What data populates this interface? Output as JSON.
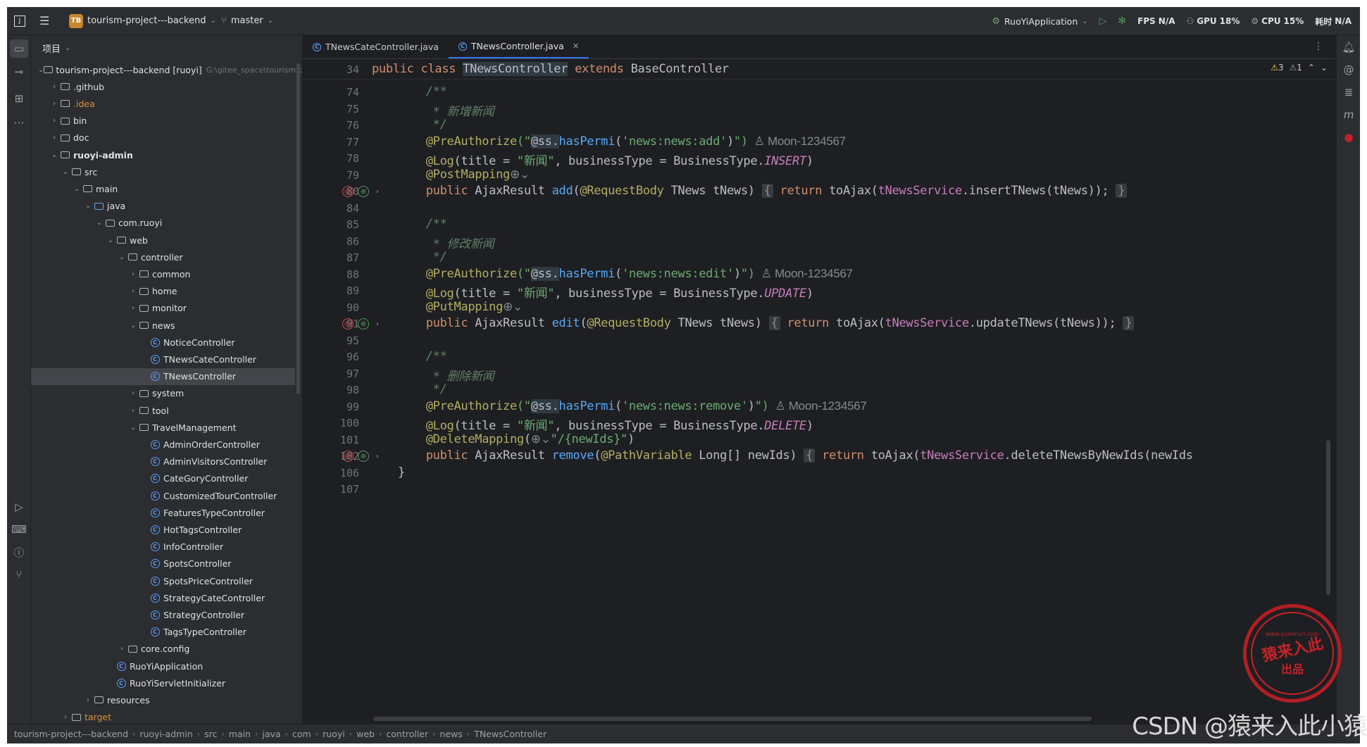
{
  "titlebar": {
    "project_badge": "TB",
    "project_name": "tourism-project---backend",
    "branch": "master",
    "run_config": "RuoYiApplication",
    "fps_label": "FPS",
    "fps_value": "N/A",
    "gpu_label": "GPU",
    "gpu_value": "18%",
    "cpu_label": "CPU",
    "cpu_value": "15%",
    "time_label": "耗时",
    "time_value": "N/A"
  },
  "project_panel": {
    "title": "项目",
    "tree": [
      {
        "label": "tourism-project---backend [ruoyi]",
        "extra": "G:\\gitee_space\\tourism-project---backend",
        "depth": 0,
        "arrow": "open",
        "icon": "module",
        "style": "root"
      },
      {
        "label": ".github",
        "depth": 1,
        "arrow": "closed",
        "icon": "folder"
      },
      {
        "label": ".idea",
        "depth": 1,
        "arrow": "closed",
        "icon": "folder",
        "style": "orange"
      },
      {
        "label": "bin",
        "depth": 1,
        "arrow": "closed",
        "icon": "folder"
      },
      {
        "label": "doc",
        "depth": 1,
        "arrow": "closed",
        "icon": "folder"
      },
      {
        "label": "ruoyi-admin",
        "depth": 1,
        "arrow": "open",
        "icon": "module",
        "style": "bold"
      },
      {
        "label": "src",
        "depth": 2,
        "arrow": "open",
        "icon": "folder"
      },
      {
        "label": "main",
        "depth": 3,
        "arrow": "open",
        "icon": "folder"
      },
      {
        "label": "java",
        "depth": 4,
        "arrow": "open",
        "icon": "folder-blue"
      },
      {
        "label": "com.ruoyi",
        "depth": 5,
        "arrow": "open",
        "icon": "package"
      },
      {
        "label": "web",
        "depth": 6,
        "arrow": "open",
        "icon": "package"
      },
      {
        "label": "controller",
        "depth": 7,
        "arrow": "open",
        "icon": "package"
      },
      {
        "label": "common",
        "depth": 8,
        "arrow": "closed",
        "icon": "package"
      },
      {
        "label": "home",
        "depth": 8,
        "arrow": "closed",
        "icon": "package"
      },
      {
        "label": "monitor",
        "depth": 8,
        "arrow": "closed",
        "icon": "package"
      },
      {
        "label": "news",
        "depth": 8,
        "arrow": "open",
        "icon": "package"
      },
      {
        "label": "NoticeController",
        "depth": 9,
        "arrow": "none",
        "icon": "class"
      },
      {
        "label": "TNewsCateController",
        "depth": 9,
        "arrow": "none",
        "icon": "class"
      },
      {
        "label": "TNewsController",
        "depth": 9,
        "arrow": "none",
        "icon": "class",
        "selected": true
      },
      {
        "label": "system",
        "depth": 8,
        "arrow": "closed",
        "icon": "package"
      },
      {
        "label": "tool",
        "depth": 8,
        "arrow": "closed",
        "icon": "package"
      },
      {
        "label": "TravelManagement",
        "depth": 8,
        "arrow": "open",
        "icon": "package"
      },
      {
        "label": "AdminOrderController",
        "depth": 9,
        "arrow": "none",
        "icon": "class"
      },
      {
        "label": "AdminVisitorsController",
        "depth": 9,
        "arrow": "none",
        "icon": "class"
      },
      {
        "label": "CateGoryController",
        "depth": 9,
        "arrow": "none",
        "icon": "class"
      },
      {
        "label": "CustomizedTourController",
        "depth": 9,
        "arrow": "none",
        "icon": "class"
      },
      {
        "label": "FeaturesTypeController",
        "depth": 9,
        "arrow": "none",
        "icon": "class"
      },
      {
        "label": "HotTagsController",
        "depth": 9,
        "arrow": "none",
        "icon": "class"
      },
      {
        "label": "InfoController",
        "depth": 9,
        "arrow": "none",
        "icon": "class"
      },
      {
        "label": "SpotsController",
        "depth": 9,
        "arrow": "none",
        "icon": "class"
      },
      {
        "label": "SpotsPriceController",
        "depth": 9,
        "arrow": "none",
        "icon": "class"
      },
      {
        "label": "StrategyCateController",
        "depth": 9,
        "arrow": "none",
        "icon": "class"
      },
      {
        "label": "StrategyController",
        "depth": 9,
        "arrow": "none",
        "icon": "class"
      },
      {
        "label": "TagsTypeController",
        "depth": 9,
        "arrow": "none",
        "icon": "class"
      },
      {
        "label": "core.config",
        "depth": 7,
        "arrow": "closed",
        "icon": "package"
      },
      {
        "label": "RuoYiApplication",
        "depth": 6,
        "arrow": "none",
        "icon": "class-run"
      },
      {
        "label": "RuoYiServletInitializer",
        "depth": 6,
        "arrow": "none",
        "icon": "class"
      },
      {
        "label": "resources",
        "depth": 4,
        "arrow": "closed",
        "icon": "folder"
      },
      {
        "label": "target",
        "depth": 2,
        "arrow": "closed",
        "icon": "folder",
        "style": "orange"
      }
    ]
  },
  "editor": {
    "tabs": [
      {
        "label": "TNewsCateController.java",
        "active": false
      },
      {
        "label": "TNewsController.java",
        "active": true
      }
    ],
    "warnings": "3",
    "weak_warnings": "1",
    "sticky_line_number": "34",
    "sticky_line": [
      {
        "t": "public class ",
        "c": "kw"
      },
      {
        "t": "TNewsController",
        "c": "hl"
      },
      {
        "t": " extends ",
        "c": "kw"
      },
      {
        "t": "BaseController",
        "c": ""
      }
    ],
    "lines": [
      {
        "n": "74",
        "tokens": [
          {
            "t": "    /**",
            "c": "cm"
          }
        ]
      },
      {
        "n": "75",
        "tokens": [
          {
            "t": "     * 新增新闻",
            "c": "cm"
          }
        ]
      },
      {
        "n": "76",
        "tokens": [
          {
            "t": "     */",
            "c": "cm"
          }
        ]
      },
      {
        "n": "77",
        "tokens": [
          {
            "t": "    @PreAuthorize",
            "c": "an"
          },
          {
            "t": "(\"",
            "c": "str"
          },
          {
            "t": "@ss.",
            "c": "hl"
          },
          {
            "t": "hasPermi",
            "c": "fn"
          },
          {
            "t": "(",
            "c": ""
          },
          {
            "t": "'news:news:add'",
            "c": "str"
          },
          {
            "t": ")",
            "c": ""
          },
          {
            "t": "\")",
            "c": "str"
          },
          {
            "t": "  ♙ Moon-1234567",
            "c": "hint"
          }
        ]
      },
      {
        "n": "78",
        "tokens": [
          {
            "t": "    @Log",
            "c": "an"
          },
          {
            "t": "(title = ",
            "c": ""
          },
          {
            "t": "\"新闻\"",
            "c": "str"
          },
          {
            "t": ", businessType = BusinessType.",
            "c": ""
          },
          {
            "t": "INSERT",
            "c": "it"
          },
          {
            "t": ")",
            "c": ""
          }
        ]
      },
      {
        "n": "79",
        "tokens": [
          {
            "t": "    @PostMapping",
            "c": "an"
          },
          {
            "t": "⊕⌄",
            "c": "hint"
          }
        ]
      },
      {
        "n": "80",
        "tokens": [
          {
            "t": "    public ",
            "c": "kw"
          },
          {
            "t": "AjaxResult ",
            "c": ""
          },
          {
            "t": "add",
            "c": "fn"
          },
          {
            "t": "(",
            "c": ""
          },
          {
            "t": "@RequestBody",
            "c": "an"
          },
          {
            "t": " TNews tNews) ",
            "c": ""
          },
          {
            "t": "{",
            "c": "fold"
          },
          {
            "t": " return ",
            "c": "kw"
          },
          {
            "t": "toAjax(",
            "c": ""
          },
          {
            "t": "tNewsService",
            "c": "fld"
          },
          {
            "t": ".insertTNews(tNews)); ",
            "c": ""
          },
          {
            "t": "}",
            "c": "fold"
          }
        ],
        "gutter": true
      },
      {
        "n": "84",
        "tokens": [
          {
            "t": "",
            "c": ""
          }
        ]
      },
      {
        "n": "85",
        "tokens": [
          {
            "t": "    /**",
            "c": "cm"
          }
        ]
      },
      {
        "n": "86",
        "tokens": [
          {
            "t": "     * 修改新闻",
            "c": "cm"
          }
        ]
      },
      {
        "n": "87",
        "tokens": [
          {
            "t": "     */",
            "c": "cm"
          }
        ]
      },
      {
        "n": "88",
        "tokens": [
          {
            "t": "    @PreAuthorize",
            "c": "an"
          },
          {
            "t": "(\"",
            "c": "str"
          },
          {
            "t": "@ss.",
            "c": "hl"
          },
          {
            "t": "hasPermi",
            "c": "fn"
          },
          {
            "t": "(",
            "c": ""
          },
          {
            "t": "'news:news:edit'",
            "c": "str"
          },
          {
            "t": ")",
            "c": ""
          },
          {
            "t": "\")",
            "c": "str"
          },
          {
            "t": "  ♙ Moon-1234567",
            "c": "hint"
          }
        ]
      },
      {
        "n": "89",
        "tokens": [
          {
            "t": "    @Log",
            "c": "an"
          },
          {
            "t": "(title = ",
            "c": ""
          },
          {
            "t": "\"新闻\"",
            "c": "str"
          },
          {
            "t": ", businessType = BusinessType.",
            "c": ""
          },
          {
            "t": "UPDATE",
            "c": "it"
          },
          {
            "t": ")",
            "c": ""
          }
        ]
      },
      {
        "n": "90",
        "tokens": [
          {
            "t": "    @PutMapping",
            "c": "an"
          },
          {
            "t": "⊕⌄",
            "c": "hint"
          }
        ]
      },
      {
        "n": "91",
        "tokens": [
          {
            "t": "    public ",
            "c": "kw"
          },
          {
            "t": "AjaxResult ",
            "c": ""
          },
          {
            "t": "edit",
            "c": "fn"
          },
          {
            "t": "(",
            "c": ""
          },
          {
            "t": "@RequestBody",
            "c": "an"
          },
          {
            "t": " TNews tNews) ",
            "c": ""
          },
          {
            "t": "{",
            "c": "fold"
          },
          {
            "t": " return ",
            "c": "kw"
          },
          {
            "t": "toAjax(",
            "c": ""
          },
          {
            "t": "tNewsService",
            "c": "fld"
          },
          {
            "t": ".updateTNews(tNews)); ",
            "c": ""
          },
          {
            "t": "}",
            "c": "fold"
          }
        ],
        "gutter": true
      },
      {
        "n": "95",
        "tokens": [
          {
            "t": "",
            "c": ""
          }
        ]
      },
      {
        "n": "96",
        "tokens": [
          {
            "t": "    /**",
            "c": "cm"
          }
        ]
      },
      {
        "n": "97",
        "tokens": [
          {
            "t": "     * 删除新闻",
            "c": "cm"
          }
        ]
      },
      {
        "n": "98",
        "tokens": [
          {
            "t": "     */",
            "c": "cm"
          }
        ]
      },
      {
        "n": "99",
        "tokens": [
          {
            "t": "    @PreAuthorize",
            "c": "an"
          },
          {
            "t": "(\"",
            "c": "str"
          },
          {
            "t": "@ss.",
            "c": "hl"
          },
          {
            "t": "hasPermi",
            "c": "fn"
          },
          {
            "t": "(",
            "c": ""
          },
          {
            "t": "'news:news:remove'",
            "c": "str"
          },
          {
            "t": ")",
            "c": ""
          },
          {
            "t": "\")",
            "c": "str"
          },
          {
            "t": "  ♙ Moon-1234567",
            "c": "hint"
          }
        ]
      },
      {
        "n": "100",
        "tokens": [
          {
            "t": "    @Log",
            "c": "an"
          },
          {
            "t": "(title = ",
            "c": ""
          },
          {
            "t": "\"新闻\"",
            "c": "str"
          },
          {
            "t": ", businessType = BusinessType.",
            "c": ""
          },
          {
            "t": "DELETE",
            "c": "it"
          },
          {
            "t": ")",
            "c": ""
          }
        ]
      },
      {
        "n": "101",
        "tokens": [
          {
            "t": "    @DeleteMapping",
            "c": "an"
          },
          {
            "t": "(",
            "c": ""
          },
          {
            "t": "⊕⌄",
            "c": "hint"
          },
          {
            "t": "\"/{newIds}\"",
            "c": "str"
          },
          {
            "t": ")",
            "c": ""
          }
        ]
      },
      {
        "n": "102",
        "tokens": [
          {
            "t": "    public ",
            "c": "kw"
          },
          {
            "t": "AjaxResult ",
            "c": ""
          },
          {
            "t": "remove",
            "c": "fn"
          },
          {
            "t": "(",
            "c": ""
          },
          {
            "t": "@PathVariable",
            "c": "an"
          },
          {
            "t": " Long[] newIds) ",
            "c": ""
          },
          {
            "t": "{",
            "c": "fold"
          },
          {
            "t": " return ",
            "c": "kw"
          },
          {
            "t": "toAjax(",
            "c": ""
          },
          {
            "t": "tNewsService",
            "c": "fld"
          },
          {
            "t": ".deleteTNewsByNewIds(newIds",
            "c": ""
          }
        ],
        "gutter": true
      },
      {
        "n": "106",
        "tokens": [
          {
            "t": "}",
            "c": ""
          }
        ]
      },
      {
        "n": "107",
        "tokens": [
          {
            "t": "",
            "c": ""
          }
        ]
      }
    ]
  },
  "statusbar": {
    "breadcrumbs": [
      "tourism-project---backend",
      "ruoyi-admin",
      "src",
      "main",
      "java",
      "com",
      "ruoyi",
      "web",
      "controller",
      "news",
      "TNewsController"
    ]
  },
  "watermark": "CSDN @猿来入此小猿",
  "seal": {
    "top": "www.yuanruci.com",
    "main": "猿来入此",
    "sub": "出品"
  },
  "colors": {
    "accent": "#3574f0",
    "background": "#1e1f22",
    "panel": "#2b2d30",
    "seal_red": "#c42229"
  }
}
